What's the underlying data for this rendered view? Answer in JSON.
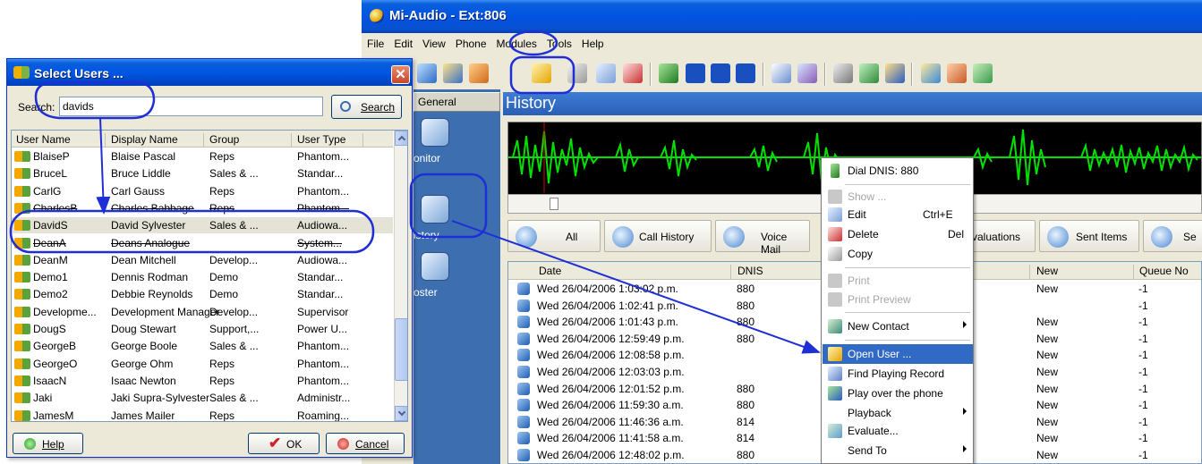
{
  "main_window": {
    "title": "Mi-Audio - Ext:806",
    "menu": [
      "File",
      "Edit",
      "View",
      "Phone",
      "Modules",
      "Tools",
      "Help"
    ],
    "nav_header": "General",
    "nav_items": [
      "onitor",
      "istory",
      "oster"
    ],
    "panel_title": "History",
    "tabs": [
      "All",
      "Call History",
      "Voice Mail",
      "valuations",
      "Sent Items",
      "Se"
    ],
    "grid_columns": [
      "Date",
      "DNIS",
      "New",
      "Queue No"
    ],
    "grid_rows": [
      {
        "date": "Wed 26/04/2006 1:03:02 p.m.",
        "dnis": "880",
        "new": "New",
        "queue": "-1"
      },
      {
        "date": "Wed 26/04/2006 1:02:41 p.m.",
        "dnis": "880",
        "new": "",
        "queue": "-1"
      },
      {
        "date": "Wed 26/04/2006 1:01:43 p.m.",
        "dnis": "880",
        "new": "New",
        "queue": "-1"
      },
      {
        "date": "Wed 26/04/2006 12:59:49 p.m.",
        "dnis": "880",
        "new": "New",
        "queue": "-1"
      },
      {
        "date": "Wed 26/04/2006 12:08:58 p.m.",
        "dnis": "",
        "new": "New",
        "queue": "-1"
      },
      {
        "date": "Wed 26/04/2006 12:03:03 p.m.",
        "dnis": "",
        "new": "New",
        "queue": "-1"
      },
      {
        "date": "Wed 26/04/2006 12:01:52 p.m.",
        "dnis": "880",
        "new": "New",
        "queue": "-1"
      },
      {
        "date": "Wed 26/04/2006 11:59:30 a.m.",
        "dnis": "880",
        "new": "New",
        "queue": "-1"
      },
      {
        "date": "Wed 26/04/2006 11:46:36 a.m.",
        "dnis": "814",
        "new": "New",
        "queue": "-1"
      },
      {
        "date": "Wed 26/04/2006 11:41:58 a.m.",
        "dnis": "814",
        "new": "New",
        "queue": "-1"
      },
      {
        "date": "Wed 26/04/2006 12:48:02 p.m.",
        "dnis": "880",
        "new": "New",
        "queue": "-1"
      }
    ]
  },
  "context_menu": {
    "dial": "Dial DNIS: 880",
    "show": "Show ...",
    "edit": "Edit",
    "edit_shortcut": "Ctrl+E",
    "delete": "Delete",
    "delete_shortcut": "Del",
    "copy": "Copy",
    "print": "Print",
    "print_preview": "Print Preview",
    "new_contact": "New Contact",
    "open_user": "Open User ...",
    "find_playing": "Find Playing Record",
    "play_phone": "Play over the phone",
    "playback": "Playback",
    "evaluate": "Evaluate...",
    "send_to": "Send To"
  },
  "dialog": {
    "title": "Select Users ...",
    "search_label": "Search:",
    "search_value": "davids",
    "search_button": "Search",
    "columns": [
      "User Name",
      "Display Name",
      "Group",
      "User Type"
    ],
    "rows": [
      {
        "user": "BlaiseP",
        "display": "Blaise Pascal",
        "group": "Reps",
        "type": "Phantom..."
      },
      {
        "user": "BruceL",
        "display": "Bruce Liddle",
        "group": "Sales & ...",
        "type": "Standar..."
      },
      {
        "user": "CarlG",
        "display": "Carl Gauss",
        "group": "Reps",
        "type": "Phantom..."
      },
      {
        "user": "CharlesB",
        "display": "Charles Babbage",
        "group": "Reps",
        "type": "Phantom..."
      },
      {
        "user": "DavidS",
        "display": "David Sylvester",
        "group": "Sales & ...",
        "type": "Audiowa..."
      },
      {
        "user": "DeanA",
        "display": "Deans Analogue",
        "group": "",
        "type": "System..."
      },
      {
        "user": "DeanM",
        "display": "Dean Mitchell",
        "group": "Develop...",
        "type": "Audiowa..."
      },
      {
        "user": "Demo1",
        "display": "Dennis Rodman",
        "group": "Demo",
        "type": "Standar..."
      },
      {
        "user": "Demo2",
        "display": "Debbie Reynolds",
        "group": "Demo",
        "type": "Standar..."
      },
      {
        "user": "Developme...",
        "display": "Development Manager",
        "group": "Develop...",
        "type": "Supervisor"
      },
      {
        "user": "DougS",
        "display": "Doug Stewart",
        "group": "Support,...",
        "type": "Power U..."
      },
      {
        "user": "GeorgeB",
        "display": "George Boole",
        "group": "Sales & ...",
        "type": "Phantom..."
      },
      {
        "user": "GeorgeO",
        "display": "George Ohm",
        "group": "Reps",
        "type": "Phantom..."
      },
      {
        "user": "IsaacN",
        "display": "Isaac  Newton",
        "group": "Reps",
        "type": "Phantom..."
      },
      {
        "user": "Jaki",
        "display": "Jaki Supra-Sylvester",
        "group": "Sales & ...",
        "type": "Administr..."
      },
      {
        "user": "JamesM",
        "display": "James Mailer",
        "group": "Reps",
        "type": "Roaming..."
      }
    ],
    "help_button": "Help",
    "ok_button": "OK",
    "cancel_button": "Cancel"
  }
}
